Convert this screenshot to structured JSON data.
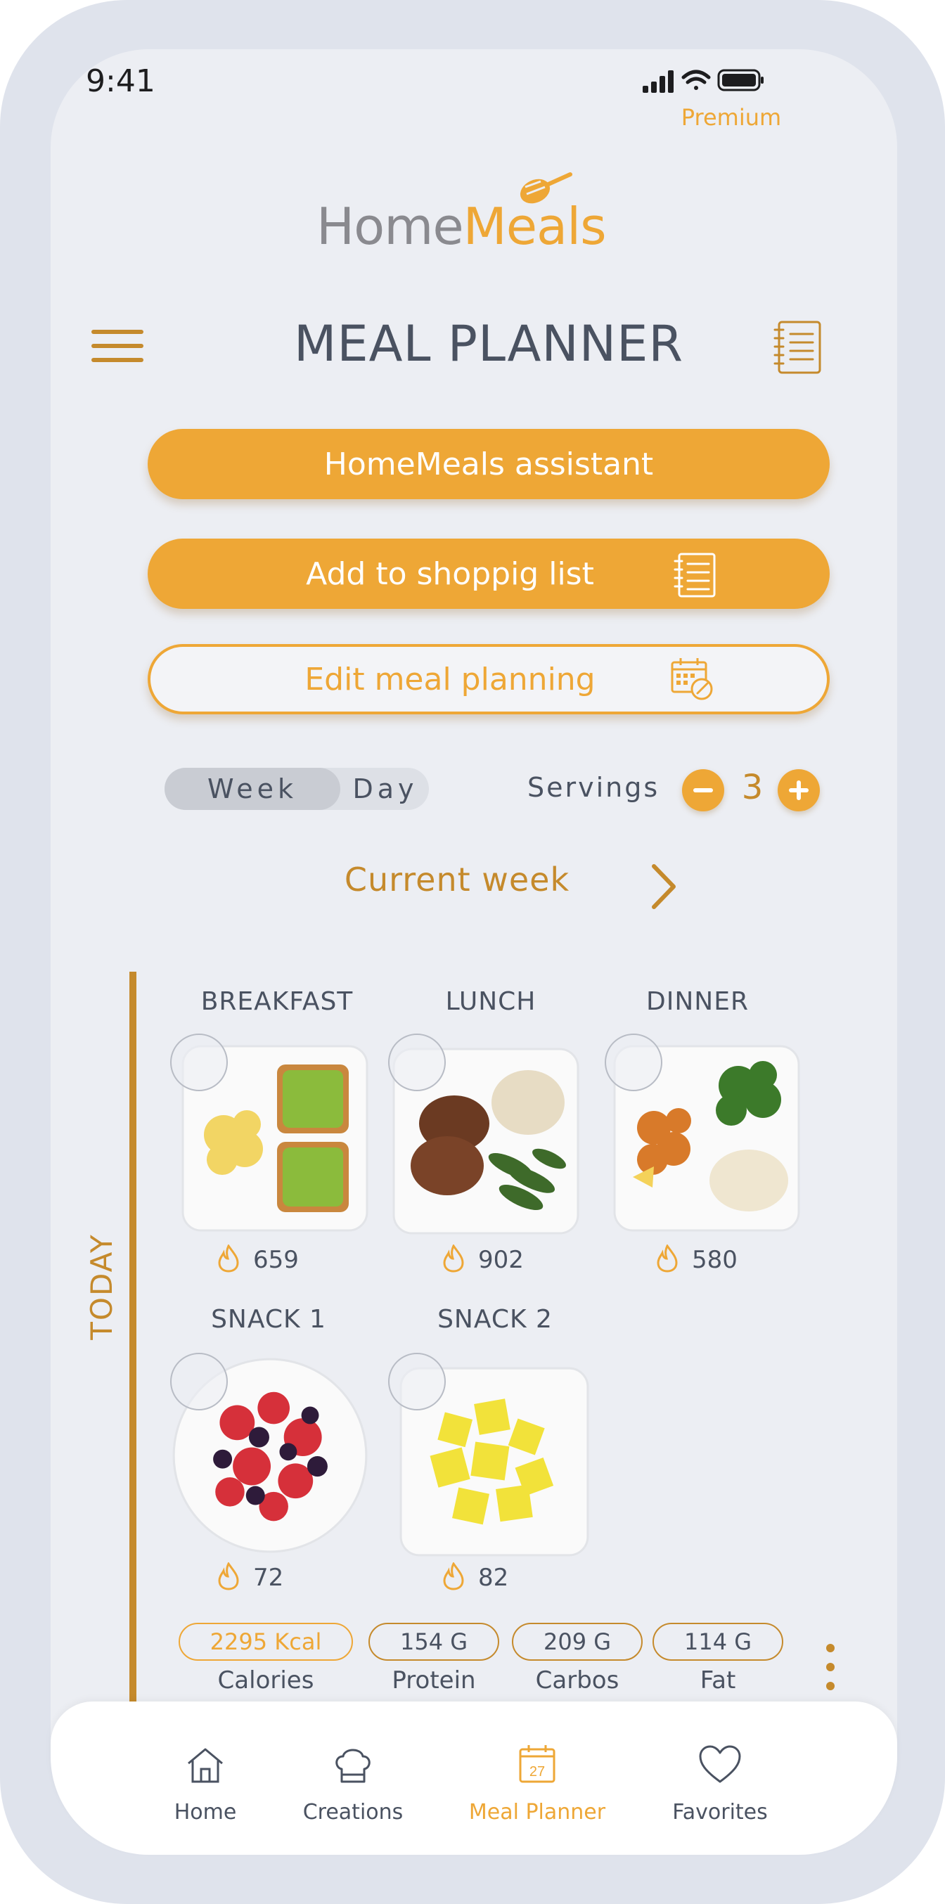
{
  "status_bar": {
    "time": "9:41",
    "premium_label": "Premium"
  },
  "logo": {
    "part1": "Home",
    "part2": "Meals"
  },
  "header": {
    "title": "MEAL PLANNER"
  },
  "buttons": {
    "assistant": "HomeMeals assistant",
    "shopping": "Add to shoppig list",
    "edit": "Edit meal planning"
  },
  "view_toggle": {
    "week": "Week",
    "day": "Day",
    "selected": "Week"
  },
  "servings": {
    "label": "Servings",
    "count": "3"
  },
  "week_nav": {
    "label": "Current week"
  },
  "today_label": "TODAY",
  "meals": [
    {
      "title": "BREAKFAST",
      "kcal": "659"
    },
    {
      "title": "LUNCH",
      "kcal": "902"
    },
    {
      "title": "DINNER",
      "kcal": "580"
    },
    {
      "title": "SNACK 1",
      "kcal": "72"
    },
    {
      "title": "SNACK 2",
      "kcal": "82"
    }
  ],
  "macros": [
    {
      "value": "2295 Kcal",
      "label": "Calories"
    },
    {
      "value": "154 G",
      "label": "Protein"
    },
    {
      "value": "209 G",
      "label": "Carbos"
    },
    {
      "value": "114 G",
      "label": "Fat"
    }
  ],
  "bottom_nav": [
    {
      "label": "Home",
      "icon": "home-icon"
    },
    {
      "label": "Creations",
      "icon": "chef-hat-icon"
    },
    {
      "label": "Meal Planner",
      "icon": "calendar-icon",
      "calendar_day": "27",
      "active": true
    },
    {
      "label": "Favorites",
      "icon": "heart-icon"
    }
  ],
  "colors": {
    "accent": "#eea736",
    "accent_dark": "#c58a2c",
    "text": "#4a5261",
    "background": "#eceef3"
  }
}
